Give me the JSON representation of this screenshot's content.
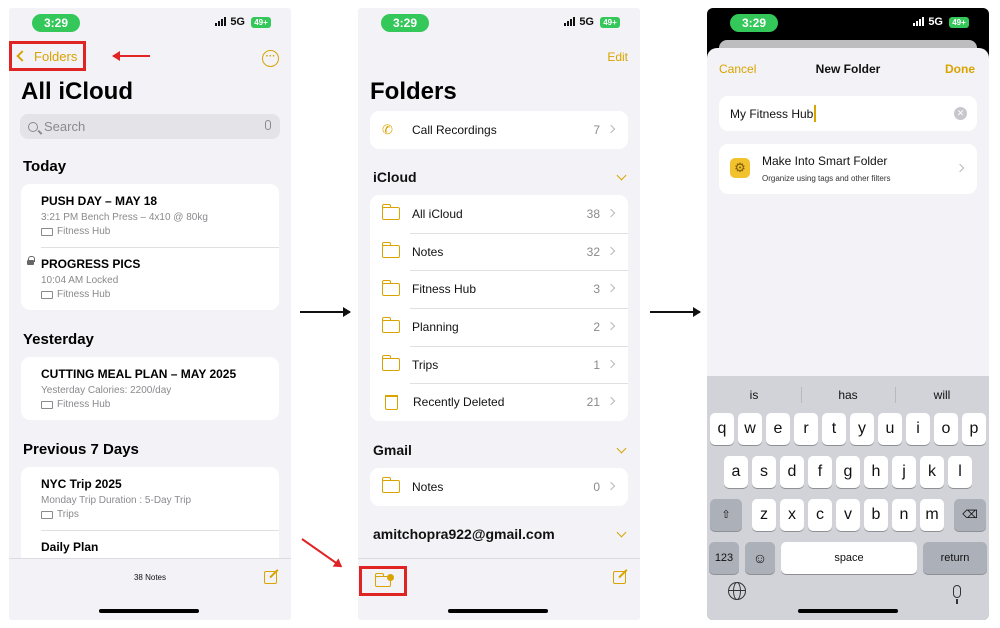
{
  "status": {
    "time": "3:29",
    "network": "5G",
    "battery": "49+"
  },
  "phone1": {
    "back_label": "Folders",
    "more_glyph": "···",
    "title": "All iCloud",
    "search_placeholder": "Search",
    "sections": [
      {
        "title": "Today",
        "notes": [
          {
            "title": "PUSH DAY – MAY 18",
            "meta": "3:21 PM  Bench Press – 4x10 @ 80kg",
            "folder": "Fitness Hub",
            "locked": false
          },
          {
            "title": "PROGRESS PICS",
            "meta": "10:04 AM  Locked",
            "folder": "Fitness Hub",
            "locked": true
          }
        ]
      },
      {
        "title": "Yesterday",
        "notes": [
          {
            "title": "CUTTING MEAL PLAN – MAY 2025",
            "meta": "Yesterday  Calories: 2200/day",
            "folder": "Fitness Hub"
          }
        ]
      },
      {
        "title": "Previous 7 Days",
        "notes": [
          {
            "title": "NYC Trip 2025",
            "meta": "Monday  Trip Duration : 5-Day Trip",
            "folder": "Trips"
          },
          {
            "title": "Daily Plan",
            "meta": "",
            "folder": ""
          }
        ]
      }
    ],
    "notes_count": "38 Notes"
  },
  "phone2": {
    "edit_label": "Edit",
    "title": "Folders",
    "call_recordings": {
      "label": "Call Recordings",
      "count": "7"
    },
    "icloud_title": "iCloud",
    "icloud_folders": [
      {
        "label": "All iCloud",
        "count": "38",
        "icon": "folder-icon"
      },
      {
        "label": "Notes",
        "count": "32",
        "icon": "folder-icon"
      },
      {
        "label": "Fitness Hub",
        "count": "3",
        "icon": "folder-icon"
      },
      {
        "label": "Planning",
        "count": "2",
        "icon": "folder-icon"
      },
      {
        "label": "Trips",
        "count": "1",
        "icon": "folder-icon"
      },
      {
        "label": "Recently Deleted",
        "count": "21",
        "icon": "trash-icon"
      }
    ],
    "gmail_title": "Gmail",
    "gmail_folders": [
      {
        "label": "Notes",
        "count": "0"
      }
    ],
    "account_title": "amitchopra922@gmail.com"
  },
  "phone3": {
    "cancel_label": "Cancel",
    "title": "New Folder",
    "done_label": "Done",
    "folder_name_value": "My Fitness Hub",
    "smart_title": "Make Into Smart Folder",
    "smart_subtitle": "Organize using tags and other filters",
    "suggestions": [
      "is",
      "has",
      "will"
    ],
    "keys_row1": [
      "q",
      "w",
      "e",
      "r",
      "t",
      "y",
      "u",
      "i",
      "o",
      "p"
    ],
    "keys_row2": [
      "a",
      "s",
      "d",
      "f",
      "g",
      "h",
      "j",
      "k",
      "l"
    ],
    "keys_row3": [
      "z",
      "x",
      "c",
      "v",
      "b",
      "n",
      "m"
    ],
    "key_numbers": "123",
    "key_space": "space",
    "key_return": "return"
  },
  "colors": {
    "accent": "#d9a400",
    "highlight": "#e02424",
    "status_green": "#34c759"
  }
}
